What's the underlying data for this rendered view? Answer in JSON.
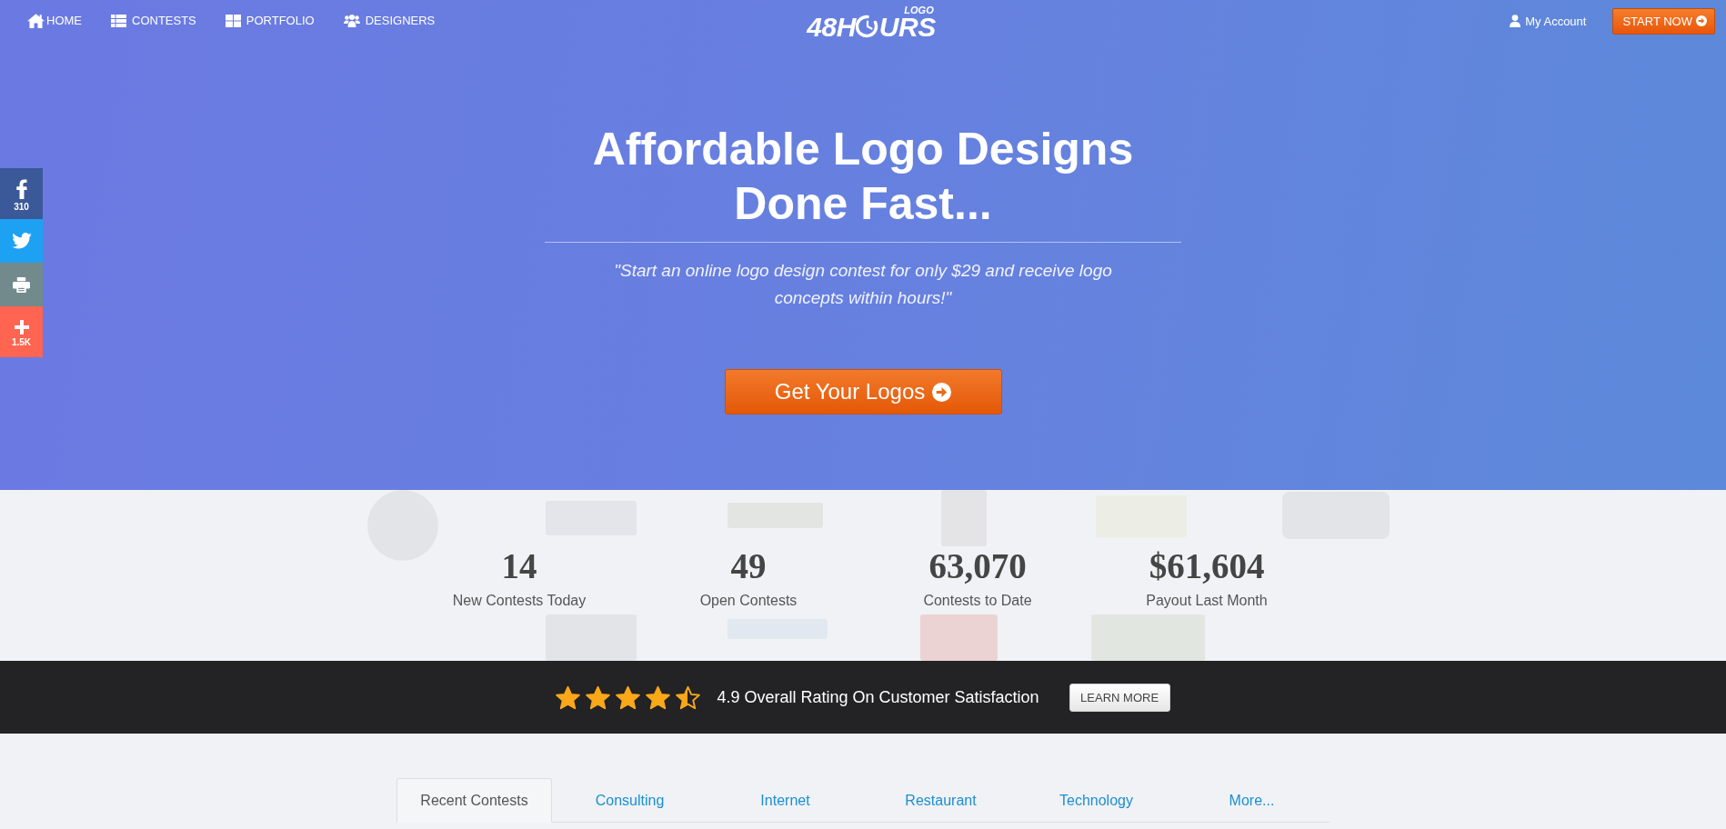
{
  "nav": {
    "links": [
      "HOME",
      "CONTESTS",
      "PORTFOLIO",
      "DESIGNERS"
    ],
    "logo": {
      "text_start": "48H",
      "text_end": "URS",
      "tagline": "LOGO"
    },
    "account": "My Account",
    "start_button": "START NOW"
  },
  "social": [
    {
      "color": "#3b5998",
      "count": "310"
    },
    {
      "color": "#1da1f2"
    },
    {
      "color": "#738a8d"
    },
    {
      "color": "#ff6550",
      "count": "1.5K"
    }
  ],
  "hero": {
    "title": "Affordable Logo Designs Done Fast...",
    "quote": "\"Start an online logo design contest for only $29 and receive logo concepts within hours!\"",
    "button": "Get Your Logos"
  },
  "stats": [
    {
      "value": "14",
      "label": "New Contests Today"
    },
    {
      "value": "49",
      "label": "Open Contests"
    },
    {
      "value": "63,070",
      "label": "Contests to Date"
    },
    {
      "value": "$61,604",
      "label": "Payout Last Month"
    }
  ],
  "rating": {
    "stars": 4.5,
    "text": "4.9 Overall Rating On Customer Satisfaction",
    "button": "LEARN MORE"
  },
  "tabs": [
    {
      "label": "Recent Contests",
      "selected": true
    },
    {
      "label": "Consulting",
      "selected": false
    },
    {
      "label": "Internet",
      "selected": false
    },
    {
      "label": "Restaurant",
      "selected": false
    },
    {
      "label": "Technology",
      "selected": false
    },
    {
      "label": "More...",
      "selected": false
    }
  ]
}
